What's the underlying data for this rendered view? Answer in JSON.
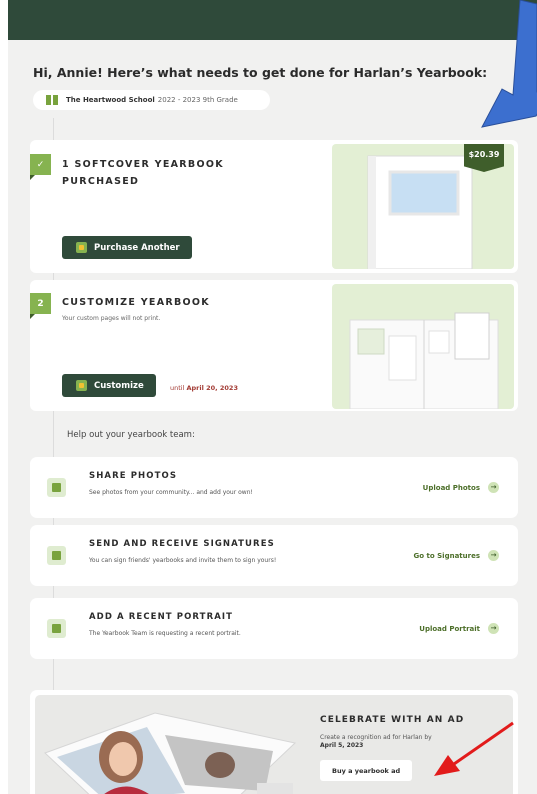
{
  "colors": {
    "header_bg": "#2f4a3a",
    "accent_green": "#86b350",
    "dark_green": "#2f4a3a",
    "light_green": "#e3efd4",
    "deadline_red": "#a33b34",
    "annotation_blue": "#3c6fcf",
    "annotation_red": "#e21b1b"
  },
  "greeting": "Hi, Annie! Here’s what needs to get done for Harlan’s Yearbook:",
  "school": {
    "icon": "book-icon",
    "name": "The Heartwood School",
    "grade": "2022 - 2023 9th Grade"
  },
  "steps": [
    {
      "badge": "✓",
      "title_line1": "1 SOFTCOVER YEARBOOK",
      "title_line2": "PURCHASED",
      "button": "Purchase Another",
      "button_icon": "bag-icon",
      "price": "$20.39"
    },
    {
      "badge": "2",
      "title": "CUSTOMIZE YEARBOOK",
      "subtitle": "Your custom pages will not print.",
      "button": "Customize",
      "button_icon": "layout-icon",
      "until_prefix": "until",
      "until_date": "April 20, 2023"
    }
  ],
  "help_label": "Help out your yearbook team:",
  "actions": [
    {
      "icon": "photo-bag-icon",
      "title": "SHARE PHOTOS",
      "subtitle": "See photos from your community... and add your own!",
      "link": "Upload Photos",
      "arrow": "→"
    },
    {
      "icon": "signature-icon",
      "title": "SEND AND RECEIVE SIGNATURES",
      "subtitle": "You can sign friends' yearbooks and invite them to sign yours!",
      "link": "Go to Signatures",
      "arrow": "→"
    },
    {
      "icon": "portrait-icon",
      "title": "ADD A RECENT PORTRAIT",
      "subtitle": "The Yearbook Team is requesting a recent portrait.",
      "link": "Upload Portrait",
      "arrow": "→"
    }
  ],
  "ad": {
    "title": "CELEBRATE WITH AN AD",
    "subtitle": "Create a recognition ad for Harlan by",
    "date": "April 5, 2023",
    "button": "Buy a yearbook ad"
  }
}
